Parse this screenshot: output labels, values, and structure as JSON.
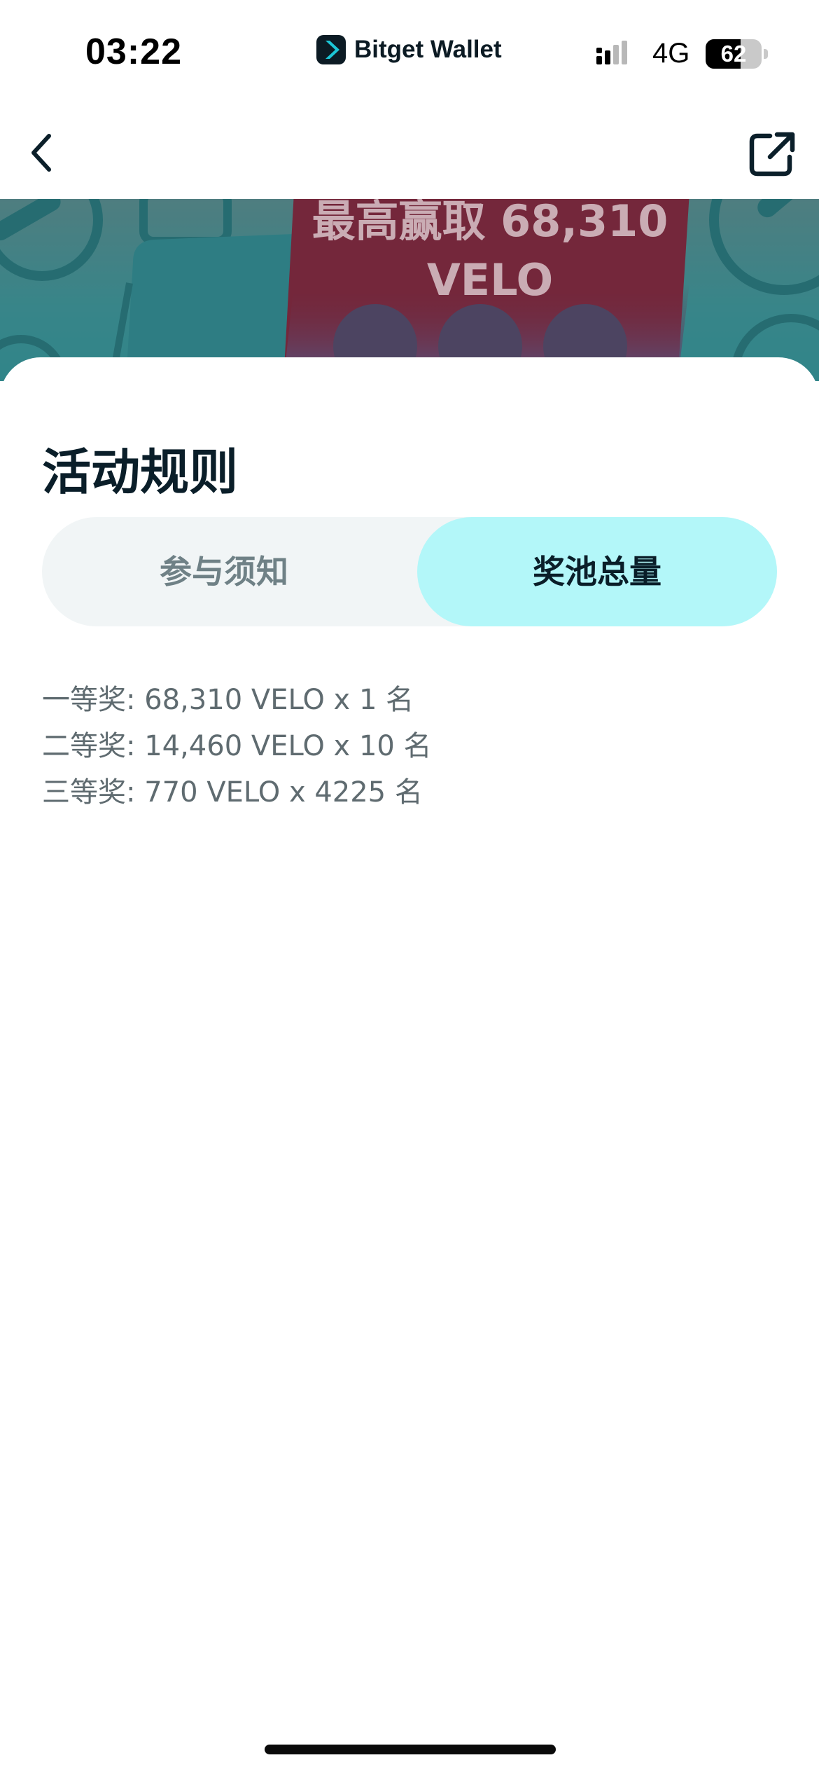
{
  "status_bar": {
    "time": "03:22",
    "app_name": "Bitget Wallet",
    "network": "4G",
    "battery": "62"
  },
  "nav": {
    "back_icon": "chevron-left-icon",
    "share_icon": "share-external-icon"
  },
  "banner": {
    "line1": "最高赢取 68,310",
    "line2": "VELO"
  },
  "sheet": {
    "title": "活动规则",
    "tabs": [
      {
        "label": "参与须知",
        "active": false
      },
      {
        "label": "奖池总量",
        "active": true
      }
    ],
    "prizes": [
      "一等奖: 68,310 VELO x 1 名",
      "二等奖: 14,460 VELO x 10 名",
      "三等奖: 770 VELO x 4225 名"
    ]
  },
  "colors": {
    "active_tab_bg": "#b3f7f9",
    "inactive_tab_bg": "#f1f5f6",
    "banner_teal": "#1fa6ad",
    "banner_card": "#6b1a33"
  }
}
